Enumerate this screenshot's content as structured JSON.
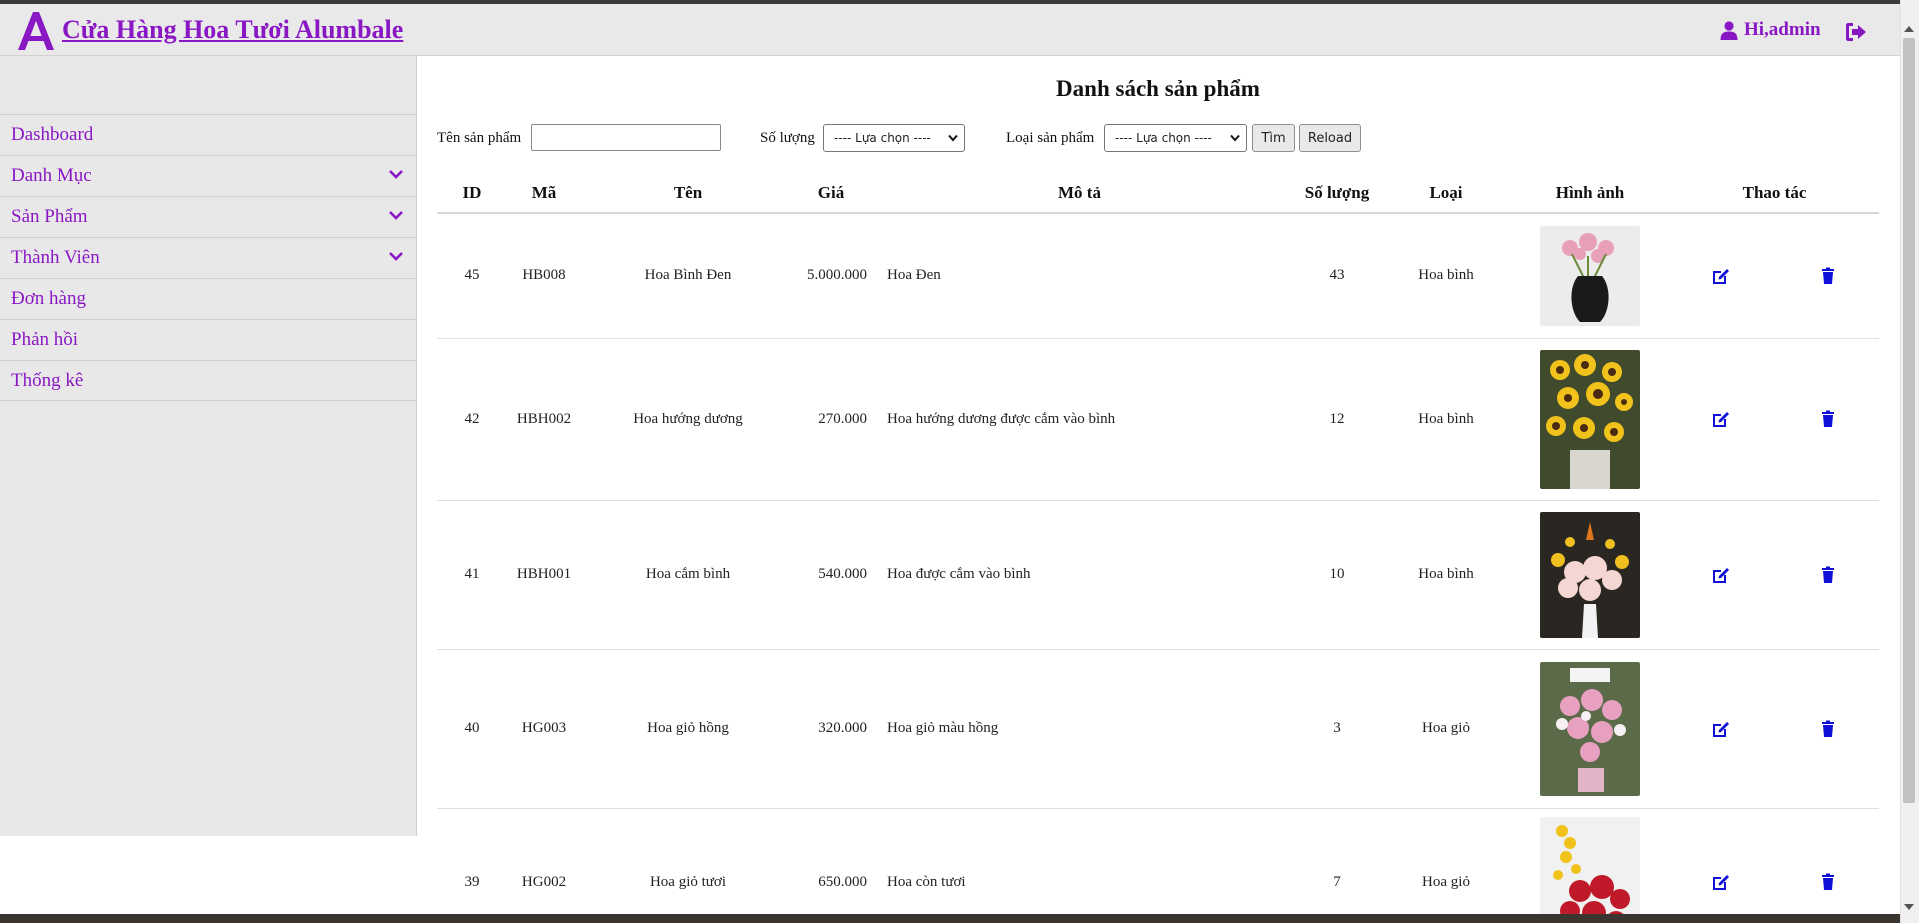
{
  "app": {
    "logo_letter": "A",
    "brand": "Cửa Hàng Hoa Tươi Alumbale",
    "accent_color": "#8a17c4",
    "user_greeting": "Hi,admin",
    "user_icon": "user-icon",
    "logout_icon": "sign-out-icon"
  },
  "sidebar": {
    "items": [
      {
        "label": "Dashboard",
        "has_submenu": false
      },
      {
        "label": "Danh Mục",
        "has_submenu": true
      },
      {
        "label": "Sản Phẩm",
        "has_submenu": true
      },
      {
        "label": "Thành Viên",
        "has_submenu": true
      },
      {
        "label": "Đơn hàng",
        "has_submenu": false
      },
      {
        "label": "Phản hồi",
        "has_submenu": false
      },
      {
        "label": "Thống kê",
        "has_submenu": false
      }
    ]
  },
  "page": {
    "title": "Danh sách sản phẩm"
  },
  "filters": {
    "name_label": "Tên sản phẩm",
    "name_value": "",
    "qty_label": "Số lượng",
    "qty_selected": "---- Lựa chọn ----",
    "type_label": "Loại sản phẩm",
    "type_selected": "---- Lựa chọn ----",
    "search_button": "Tìm",
    "reload_button": "Reload"
  },
  "table": {
    "columns": [
      "ID",
      "Mã",
      "Tên",
      "Giá",
      "Mô tả",
      "Số lượng",
      "Loại",
      "Hình ảnh",
      "Thao tác"
    ],
    "rows": [
      {
        "id": "45",
        "code": "HB008",
        "name": "Hoa Bình Đen",
        "price": "5.000.000",
        "desc": "Hoa Đen",
        "qty": "43",
        "type": "Hoa bình",
        "image": "black-vase-flowers"
      },
      {
        "id": "42",
        "code": "HBH002",
        "name": "Hoa hướng dương",
        "price": "270.000",
        "desc": "Hoa hướng dương được cắm vào bình",
        "qty": "12",
        "type": "Hoa bình",
        "image": "sunflower-vase"
      },
      {
        "id": "41",
        "code": "HBH001",
        "name": "Hoa cắm bình",
        "price": "540.000",
        "desc": "Hoa được cắm vào bình",
        "qty": "10",
        "type": "Hoa bình",
        "image": "white-pink-arrangement"
      },
      {
        "id": "40",
        "code": "HG003",
        "name": "Hoa giỏ hồng",
        "price": "320.000",
        "desc": "Hoa giỏ màu hồng",
        "qty": "3",
        "type": "Hoa giỏ",
        "image": "pink-basket"
      },
      {
        "id": "39",
        "code": "HG002",
        "name": "Hoa giỏ tươi",
        "price": "650.000",
        "desc": "Hoa còn tươi",
        "qty": "7",
        "type": "Hoa giỏ",
        "image": "red-yellow-basket"
      }
    ],
    "edit_icon": "edit-icon",
    "delete_icon": "trash-icon",
    "action_color": "#1010d8"
  }
}
